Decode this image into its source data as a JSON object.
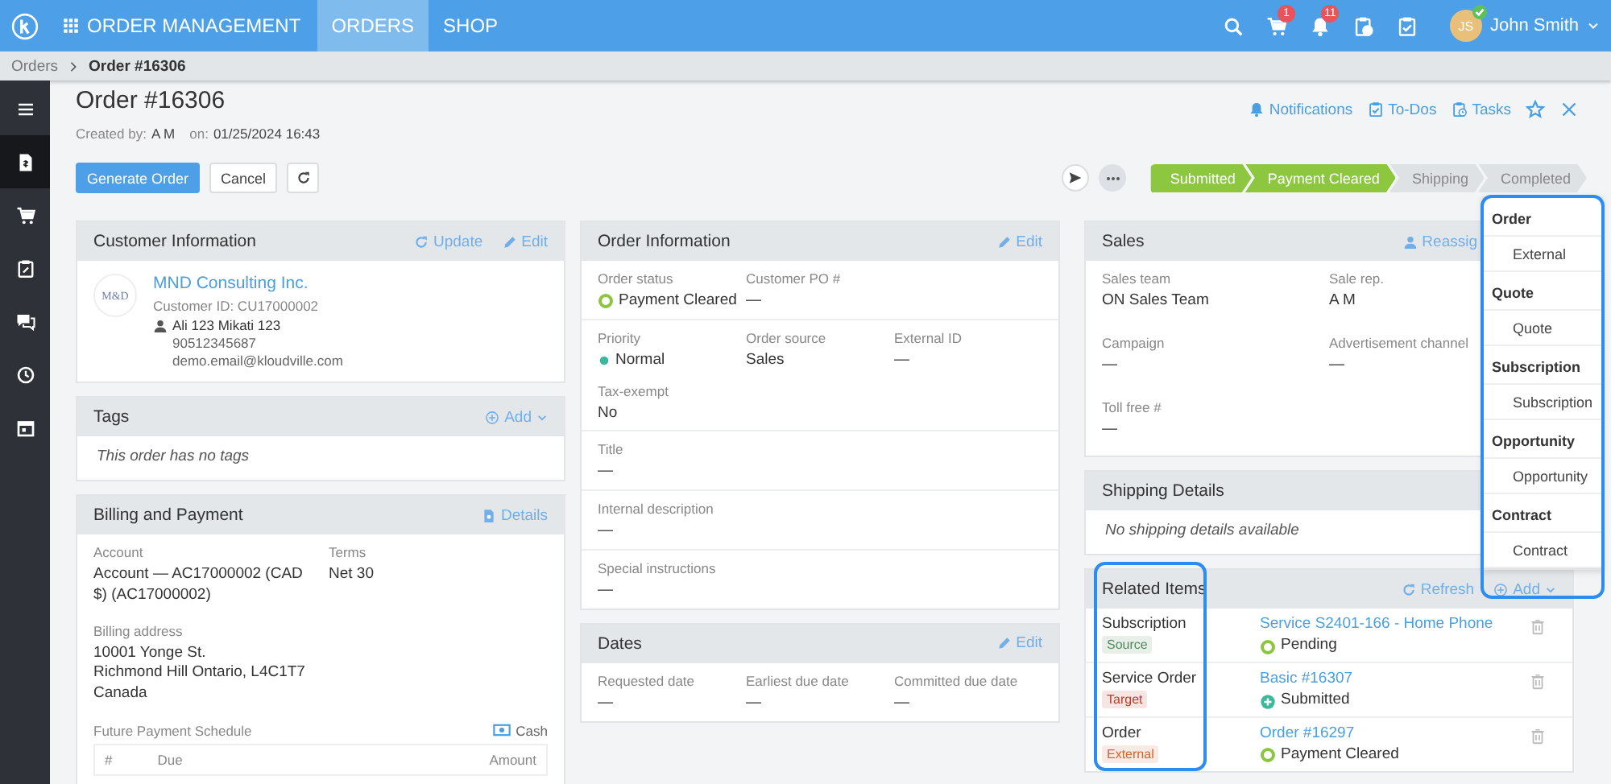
{
  "topbar": {
    "app_name": "ORDER MANAGEMENT",
    "nav_tabs": [
      {
        "label": "ORDERS",
        "selected": true
      },
      {
        "label": "SHOP",
        "selected": false
      }
    ],
    "toolbar": [
      {
        "kind": "search"
      },
      {
        "kind": "cart",
        "badge": "1"
      },
      {
        "kind": "bell",
        "badge": "11"
      },
      {
        "kind": "clipboard-clock"
      },
      {
        "kind": "clipboard-check"
      }
    ],
    "user": {
      "initials": "JS",
      "name": "John Smith",
      "online": true
    }
  },
  "breadcrumb": [
    {
      "label": "Orders",
      "current": false
    },
    {
      "label": "Order #16306",
      "current": true
    }
  ],
  "sidebar": {
    "items": [
      {
        "kind": "menu",
        "selected": false
      },
      {
        "kind": "document",
        "selected": true
      },
      {
        "kind": "cart",
        "selected": false
      },
      {
        "kind": "clipboard",
        "selected": false
      },
      {
        "kind": "chat",
        "selected": false
      },
      {
        "kind": "clock",
        "selected": false
      },
      {
        "kind": "calendar",
        "selected": false
      }
    ]
  },
  "header": {
    "title": "Order #16306",
    "created_by_label": "Created by:",
    "created_by": "A M",
    "created_on_label": "on:",
    "created_on": "01/25/2024 16:43",
    "links": [
      {
        "label": "Notifications",
        "kind": "bell"
      },
      {
        "label": "To-Dos",
        "kind": "clipboard-check"
      },
      {
        "label": "Tasks",
        "kind": "clipboard-clock"
      }
    ],
    "buttons": [
      {
        "label": "Generate Order",
        "kind": "primary"
      },
      {
        "label": "Cancel",
        "kind": "default"
      }
    ]
  },
  "progress": [
    {
      "label": "Submitted",
      "done": true
    },
    {
      "label": "Payment Cleared",
      "done": true
    },
    {
      "label": "Shipping",
      "done": false
    },
    {
      "label": "Completed",
      "done": false
    }
  ],
  "columns": [
    [
      {
        "kind": "customer",
        "title": "Customer Information",
        "actions": [
          {
            "label": "Update",
            "kind": "refresh"
          },
          {
            "label": "Edit",
            "kind": "edit"
          }
        ],
        "customer": {
          "logo_text": "M&D",
          "name": "MND Consulting Inc.",
          "id_label": "Customer ID:",
          "id": "CU17000002",
          "contact": "Ali 123 Mikati 123",
          "phone": "90512345687",
          "email": "demo.email@kloudville.com"
        }
      },
      {
        "kind": "message",
        "title": "Tags",
        "actions": [
          {
            "label": "Add",
            "kind": "add"
          }
        ],
        "message": "This order has no tags"
      },
      {
        "kind": "fields",
        "title": "Billing and Payment",
        "actions": [
          {
            "label": "Details",
            "kind": "details"
          }
        ],
        "sections": [
          [
            {
              "label": "Account",
              "value": "Account — AC17000002 (CAD $) (AC17000002)"
            },
            {
              "label": "Terms",
              "value": "Net 30"
            },
            {
              "label": "Billing address",
              "value": "10001 Yonge St.\nRichmond Hill Ontario, L4C1T7\nCanada"
            }
          ]
        ],
        "schedule": {
          "label": "Future Payment Schedule",
          "action": "Cash",
          "columns": [
            "#",
            "Due",
            "Amount"
          ]
        }
      }
    ],
    [
      {
        "kind": "fields",
        "title": "Order Information",
        "actions": [
          {
            "label": "Edit",
            "kind": "edit"
          }
        ],
        "sections": [
          [
            {
              "label": "Order status",
              "value": "Payment Cleared",
              "kind": "ring"
            },
            {
              "label": "Customer PO #",
              "value": "—"
            }
          ],
          [
            {
              "label": "Priority",
              "value": "Normal",
              "kind": "dot"
            },
            {
              "label": "Order source",
              "value": "Sales"
            },
            {
              "label": "External ID",
              "value": "—"
            },
            {
              "label": "Tax-exempt",
              "value": "No"
            }
          ],
          [
            {
              "label": "Title",
              "value": "—"
            }
          ],
          [
            {
              "label": "Internal description",
              "value": "—"
            }
          ],
          [
            {
              "label": "Special instructions",
              "value": "—"
            }
          ]
        ]
      },
      {
        "kind": "fields",
        "title": "Dates",
        "actions": [
          {
            "label": "Edit",
            "kind": "edit"
          }
        ],
        "sections": [
          [
            {
              "label": "Requested date",
              "value": "—"
            },
            {
              "label": "Earliest due date",
              "value": "—"
            },
            {
              "label": "Committed due date",
              "value": "—"
            }
          ]
        ]
      }
    ],
    [
      {
        "kind": "fields",
        "title": "Sales",
        "actions": [
          {
            "label": "Reassig",
            "kind": "user"
          }
        ],
        "sections": [
          [
            {
              "label": "Sales team",
              "value": "ON Sales Team"
            },
            {
              "label": "Sale rep.",
              "value": "A M"
            },
            {
              "label": "Campaign",
              "value": "—"
            },
            {
              "label": "Advertisement channel",
              "value": "—"
            },
            {
              "label": "Toll free #",
              "value": "—"
            }
          ]
        ]
      },
      {
        "kind": "message",
        "title": "Shipping Details",
        "message": "No shipping details available"
      },
      {
        "kind": "related",
        "title": "Related Items",
        "actions": [
          {
            "label": "Refresh",
            "kind": "refresh"
          },
          {
            "label": "Add",
            "kind": "add"
          }
        ],
        "items": [
          {
            "type": "Subscription",
            "tag": "Source",
            "color": "#4f8a5b",
            "link": "Service S2401-166 - Home Phone",
            "status": {
              "label": "Pending",
              "kind": "ring"
            }
          },
          {
            "type": "Service Order",
            "tag": "Target",
            "color": "#c0392b",
            "link": "Basic #16307",
            "status": {
              "label": "Submitted",
              "kind": "plus"
            }
          },
          {
            "type": "Order",
            "tag": "External",
            "color": "#d2642e",
            "link": "Order #16297",
            "status": {
              "label": "Payment Cleared",
              "kind": "ring"
            }
          }
        ]
      }
    ]
  ],
  "add_menu": {
    "open": true,
    "groups": [
      {
        "title": "Order",
        "items": [
          "External"
        ]
      },
      {
        "title": "Quote",
        "items": [
          "Quote"
        ]
      },
      {
        "title": "Subscription",
        "items": [
          "Subscription"
        ]
      },
      {
        "title": "Opportunity",
        "items": [
          "Opportunity"
        ]
      },
      {
        "title": "Contract",
        "items": [
          "Contract"
        ]
      }
    ]
  }
}
